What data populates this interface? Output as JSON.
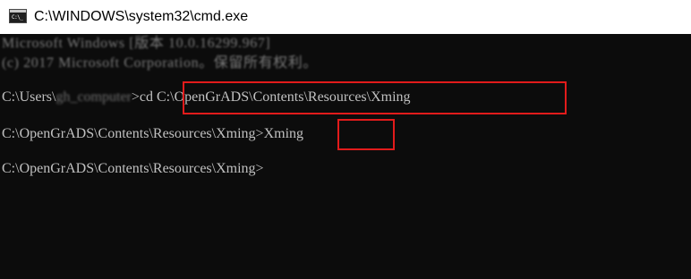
{
  "window": {
    "title": "C:\\WINDOWS\\system32\\cmd.exe",
    "icon": "cmd-console-icon",
    "icon_glyph": "C:\\_"
  },
  "console": {
    "line1_blurred": "Microsoft Windows [版本 10.0.16299.967]",
    "line2_blurred": "(c) 2017 Microsoft Corporation。保留所有权利。",
    "line3_prefix": "C:\\Users\\",
    "line3_user_blurred": "gh_computer",
    "line3_prompt_char": ">",
    "line3_command": "cd C:\\OpenGrADS\\Contents\\Resources\\Xming",
    "line4_prompt": "C:\\OpenGrADS\\Contents\\Resources\\Xming>",
    "line4_command": "Xming",
    "line5_prompt": "C:\\OpenGrADS\\Contents\\Resources\\Xming>"
  },
  "colors": {
    "console_bg": "#0c0c0c",
    "console_text": "#c0c0c0",
    "highlight": "#e21b1b",
    "titlebar_bg": "#ffffff"
  }
}
